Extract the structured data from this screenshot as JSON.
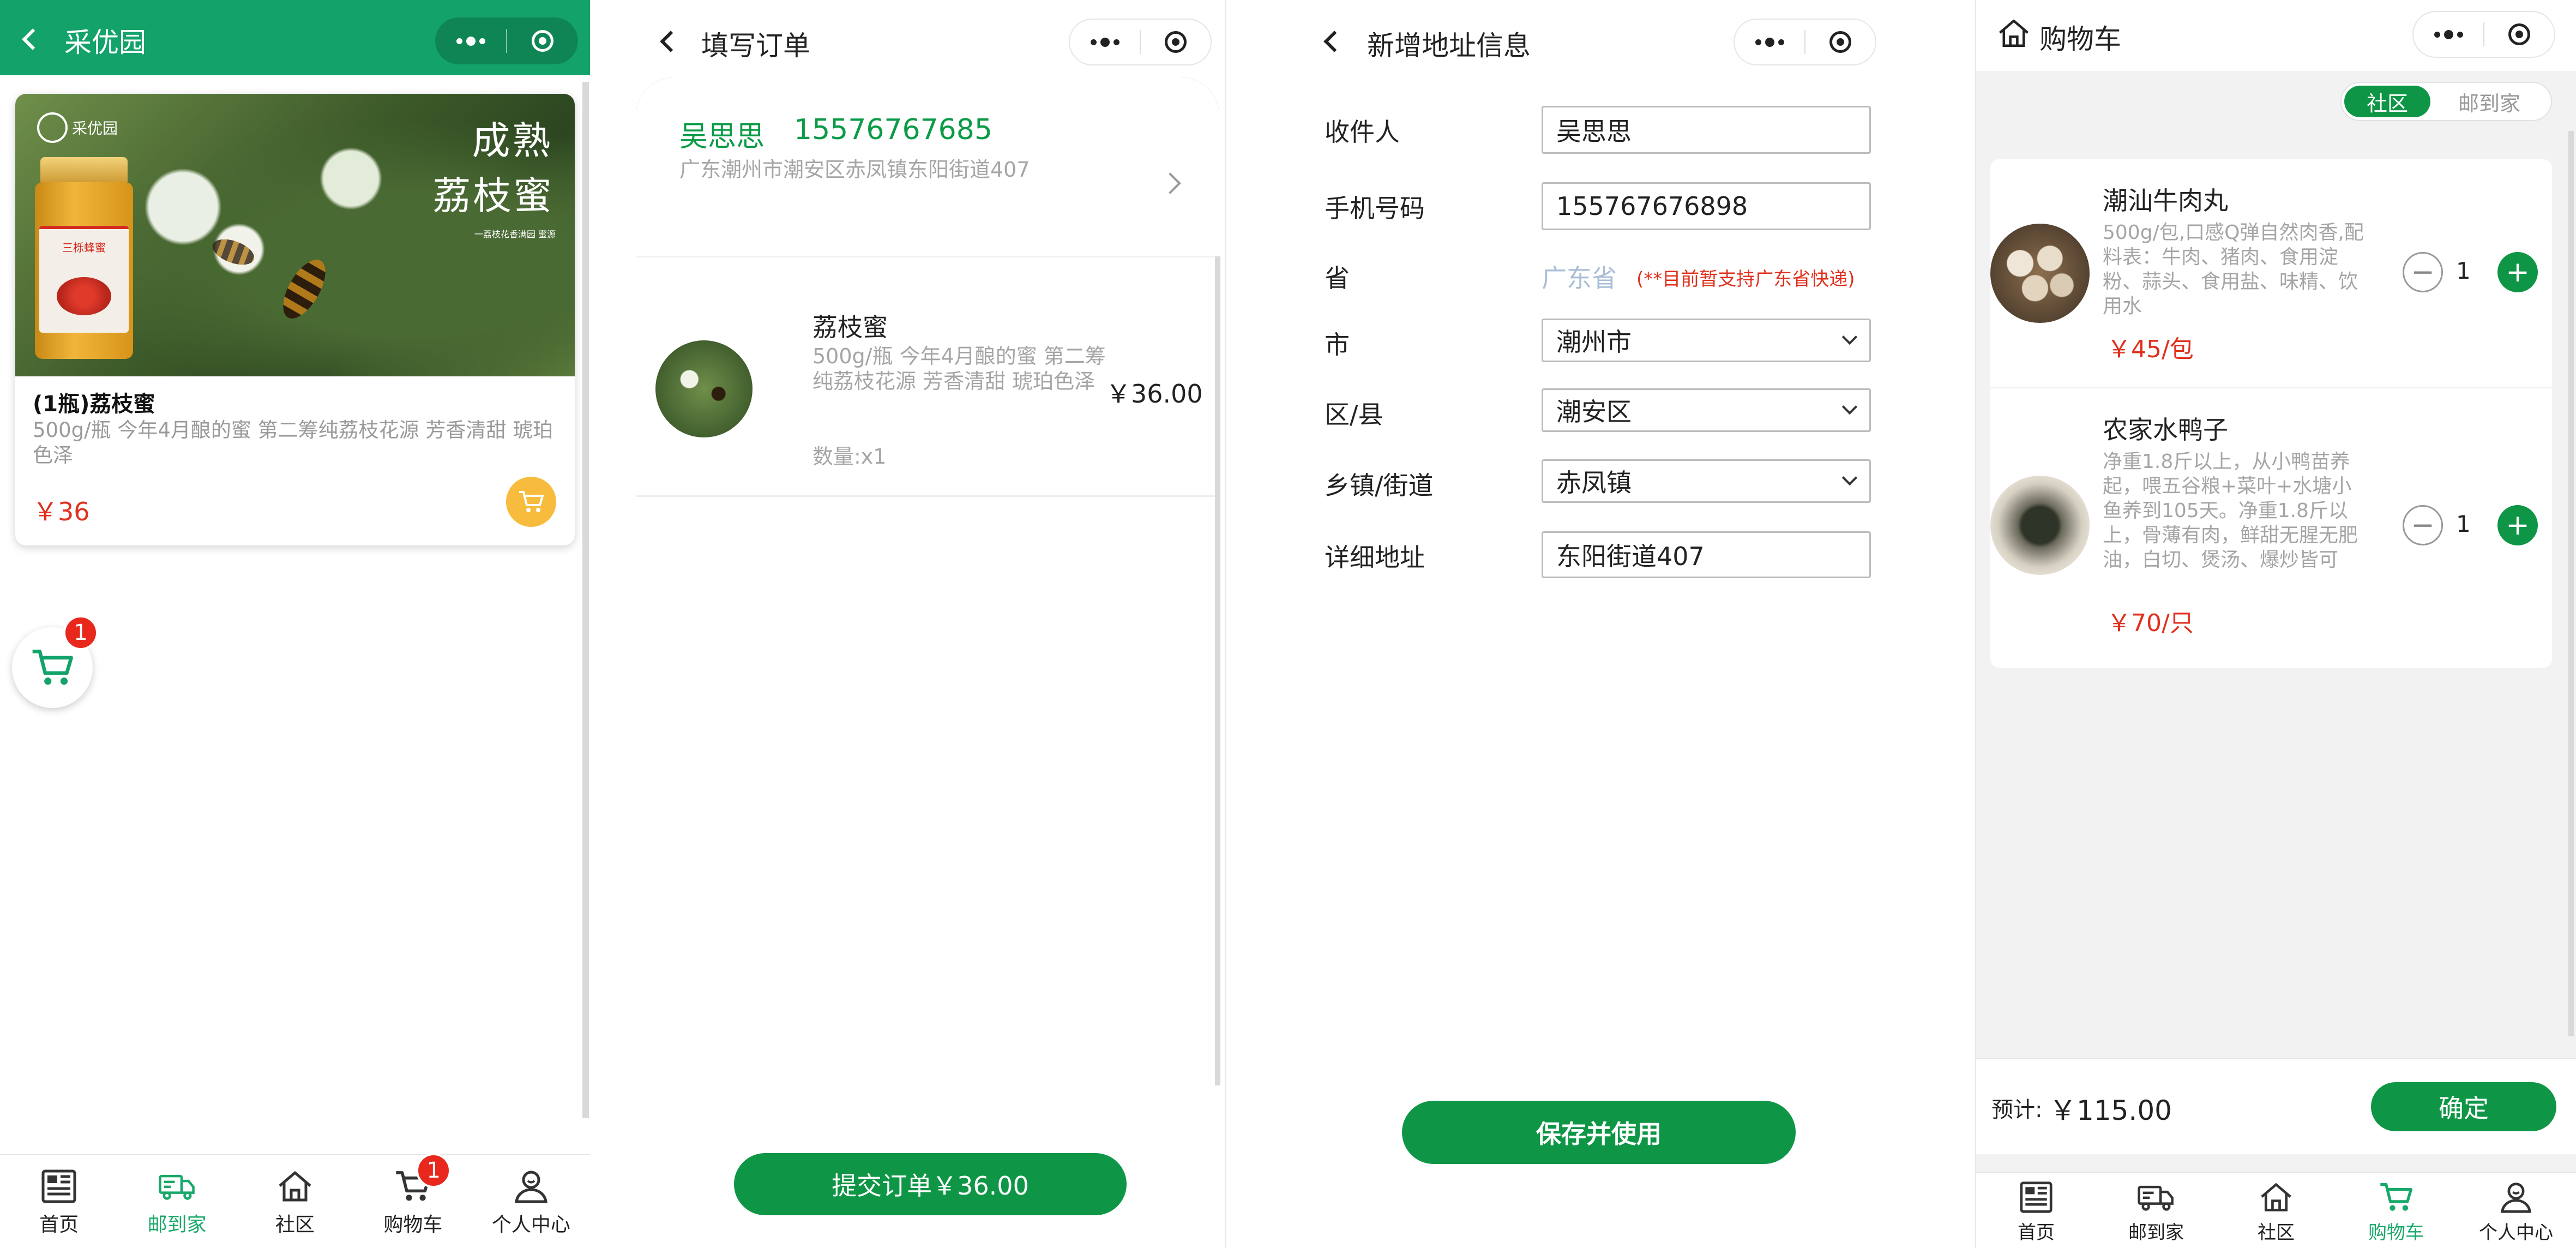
{
  "colors": {
    "brand_green": "#0e9646",
    "header_green": "#13a36a",
    "price_red": "#e0301e",
    "cart_yellow": "#f7bc3e",
    "badge_red": "#e8281c"
  },
  "tabbar": {
    "items": [
      {
        "label": "首页",
        "icon": "home-list-icon"
      },
      {
        "label": "邮到家",
        "icon": "delivery-truck-icon"
      },
      {
        "label": "社区",
        "icon": "house-icon"
      },
      {
        "label": "购物车",
        "icon": "cart-icon"
      },
      {
        "label": "个人中心",
        "icon": "user-icon"
      }
    ]
  },
  "screen1": {
    "title": "采优园",
    "banner": {
      "brand": "采优园",
      "headline_line1": "成熟",
      "headline_line2": "荔枝蜜",
      "jar_label": "三栎蜂蜜",
      "tagline": "一荔枝花香满园 蜜源"
    },
    "product": {
      "name": "(1瓶)荔枝蜜",
      "desc": "500g/瓶 今年4月酿的蜜 第二筹纯荔枝花源 芳香清甜 琥珀色泽",
      "price": "￥36"
    },
    "float_cart_badge": "1",
    "tab_cart_badge": "1"
  },
  "screen2": {
    "title": "填写订单",
    "address": {
      "name": "吴思思",
      "phone": "15576767685",
      "detail": "广东潮州市潮安区赤凤镇东阳街道407"
    },
    "item": {
      "name": "荔枝蜜",
      "desc": "500g/瓶 今年4月酿的蜜 第二筹纯荔枝花源 芳香清甜 琥珀色泽",
      "price": "￥36.00",
      "qty": "数量:x1"
    },
    "submit_label": "提交订单￥36.00"
  },
  "screen3": {
    "title": "新增地址信息",
    "fields": {
      "receiver": {
        "label": "收件人",
        "value": "吴思思"
      },
      "phone": {
        "label": "手机号码",
        "value": "155767676898"
      },
      "province": {
        "label": "省",
        "value": "广东省",
        "note": "(**目前暂支持广东省快递)"
      },
      "city": {
        "label": "市",
        "value": "潮州市"
      },
      "district": {
        "label": "区/县",
        "value": "潮安区"
      },
      "town": {
        "label": "乡镇/街道",
        "value": "赤凤镇"
      },
      "detail": {
        "label": "详细地址",
        "value": "东阳街道407"
      }
    },
    "save_label": "保存并使用"
  },
  "screen4": {
    "title": "购物车",
    "segment": {
      "options": [
        "社区",
        "邮到家"
      ],
      "selected": "社区"
    },
    "items": [
      {
        "name": "潮汕牛肉丸",
        "desc": "500g/包,口感Q弹自然肉香,配料表：牛肉、猪肉、食用淀粉、蒜头、食用盐、味精、饮用水",
        "price": "￥45/包",
        "qty": "1"
      },
      {
        "name": "农家水鸭子",
        "desc": "净重1.8斤以上，从小鸭苗养起，喂五谷粮+菜叶+水塘小鱼养到105天。净重1.8斤以上，骨薄有肉，鲜甜无腥无肥油，白切、煲汤、爆炒皆可",
        "price": "￥70/只",
        "qty": "1"
      }
    ],
    "total_label": "预计:",
    "total_value": "￥115.00",
    "confirm_label": "确定"
  }
}
